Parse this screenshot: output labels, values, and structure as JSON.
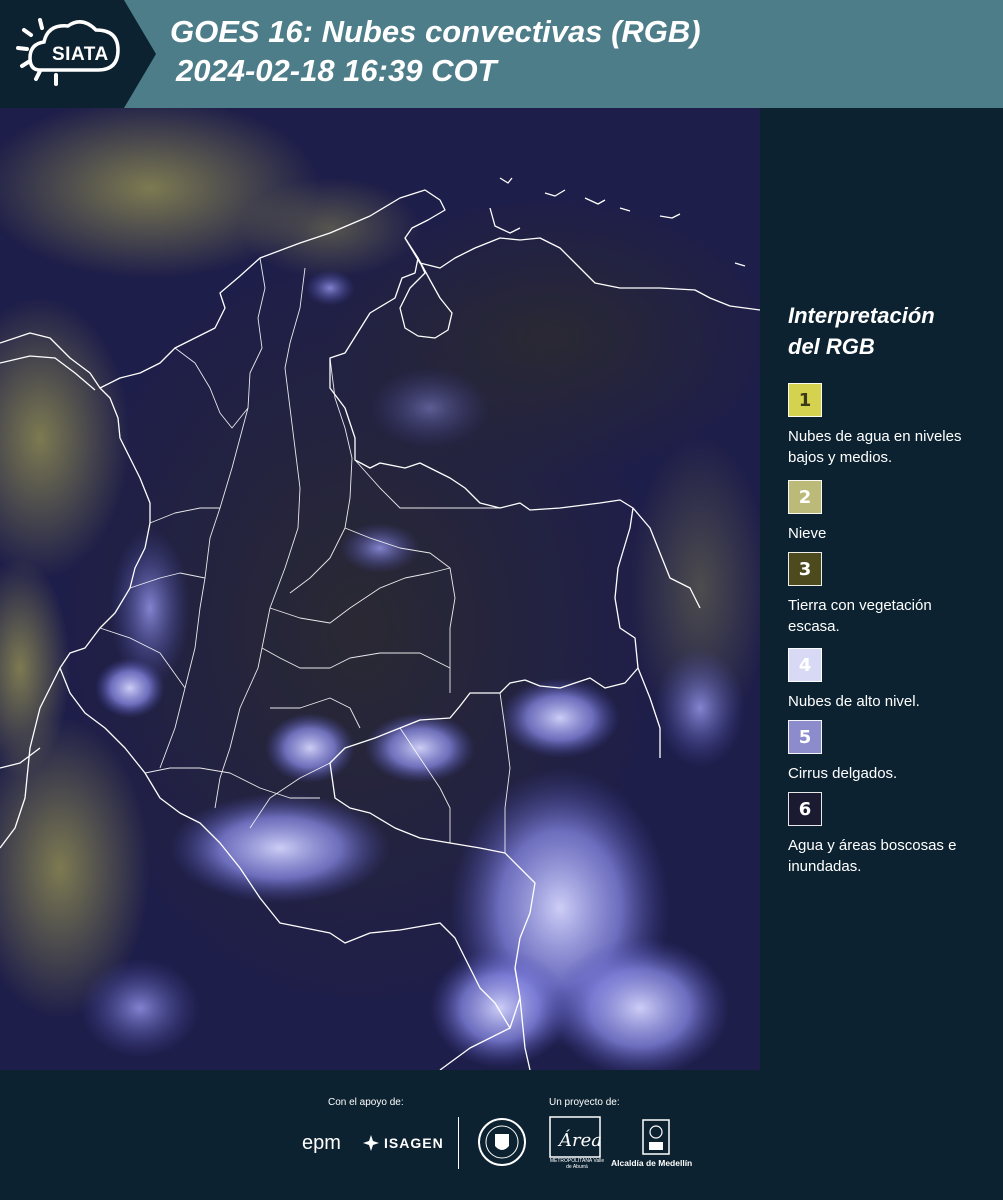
{
  "header": {
    "logo_text": "SIATA",
    "title_line1": "GOES 16: Nubes convectivas (RGB)",
    "title_line2": "2024-02-18 16:39 COT",
    "background_color": "#4e7d8a",
    "logo_background_color": "#0d2230"
  },
  "map": {
    "description_icon": "satellite-rgb-map",
    "background_color": "#1d1d4a",
    "boundary_color": "#ffffff"
  },
  "legend": {
    "title": "Interpretación\ndel RGB",
    "items": [
      {
        "number": "1",
        "label": "Nubes de agua en niveles bajos y medios.",
        "color": "#d5d250",
        "text_color": "#3a3a18"
      },
      {
        "number": "2",
        "label": "Nieve",
        "color": "#bcba78",
        "text_color": "#ffffff"
      },
      {
        "number": "3",
        "label": "Tierra con vegetación escasa.",
        "color": "#4d4a1e",
        "text_color": "#ffffff"
      },
      {
        "number": "4",
        "label": "Nubes de alto nivel.",
        "color": "#d8d9f5",
        "text_color": "#ffffff"
      },
      {
        "number": "5",
        "label": "Cirrus delgados.",
        "color": "#8c8ccd",
        "text_color": "#ffffff"
      },
      {
        "number": "6",
        "label": "Agua y áreas boscosas e inundadas.",
        "color": "#1a1b31",
        "text_color": "#ffffff"
      }
    ]
  },
  "footer": {
    "support_caption": "Con el apoyo de:",
    "project_caption": "Un proyecto de:",
    "sponsor_epm": "epm",
    "sponsor_isagen": "ISAGEN",
    "area_metro": "Área",
    "area_metro_sub": "METROPOLITANA Valle de Aburrá",
    "alcaldia": "Alcaldía de Medellín"
  }
}
